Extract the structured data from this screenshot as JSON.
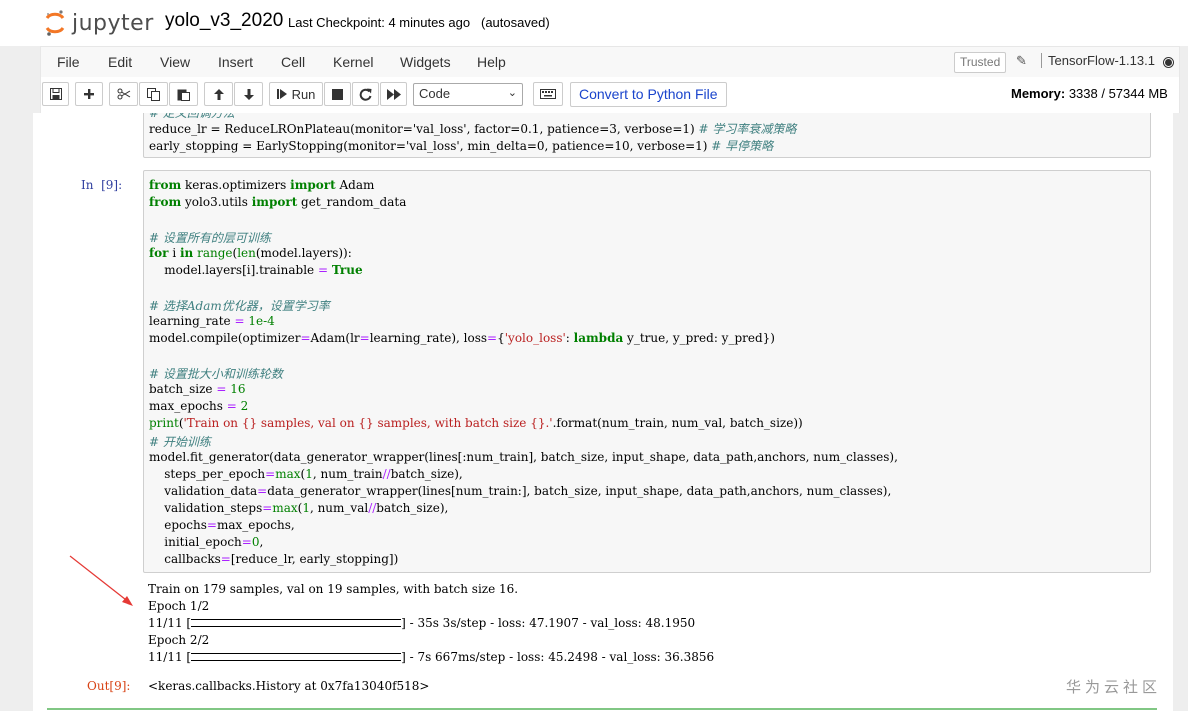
{
  "header": {
    "logo_text": "jupyter",
    "notebook_name": "yolo_v3_2020",
    "checkpoint": "Last Checkpoint: 4 minutes ago",
    "autosave": "(autosaved)"
  },
  "menubar": {
    "items": [
      "File",
      "Edit",
      "View",
      "Insert",
      "Cell",
      "Kernel",
      "Widgets",
      "Help"
    ],
    "trusted_label": "Trusted",
    "kernel_name": "TensorFlow-1.13.1"
  },
  "toolbar": {
    "run_label": "Run",
    "cell_type": "Code",
    "convert_label": "Convert to Python File",
    "memory_label": "Memory:",
    "memory_value": "3338 / 57344 MB"
  },
  "cells": {
    "prev_partial": {
      "line1": "# 定义回调方法",
      "line2_code": "reduce_lr = ReduceLROnPlateau(monitor='val_loss', factor=0.1, patience=3, verbose=1)",
      "line2_comment": "# 学习率衰减策略",
      "line3_code": "early_stopping = EarlyStopping(monitor='val_loss', min_delta=0, patience=10, verbose=1)",
      "line3_comment": "# 早停策略"
    },
    "cell9": {
      "in_prompt": "In  [9]:",
      "out_prompt": "Out[9]:",
      "output_lines": [
        "Train on 179 samples, val on 19 samples, with batch size 16.",
        "Epoch 1/2",
        "11/11 [",
        "] - 35s 3s/step - loss: 47.1907 - val_loss: 48.1950",
        "Epoch 2/2",
        "11/11 [",
        "] - 7s 667ms/step - loss: 45.2498 - val_loss: 36.3856"
      ],
      "out_value": "<keras.callbacks.History at 0x7fa13040f518>"
    }
  },
  "watermark": "华为云社区",
  "colors": {
    "keyword": "#008000",
    "string": "#ba2121",
    "comment": "#408080",
    "in_prompt": "#303f9f",
    "out_prompt": "#d84315"
  }
}
